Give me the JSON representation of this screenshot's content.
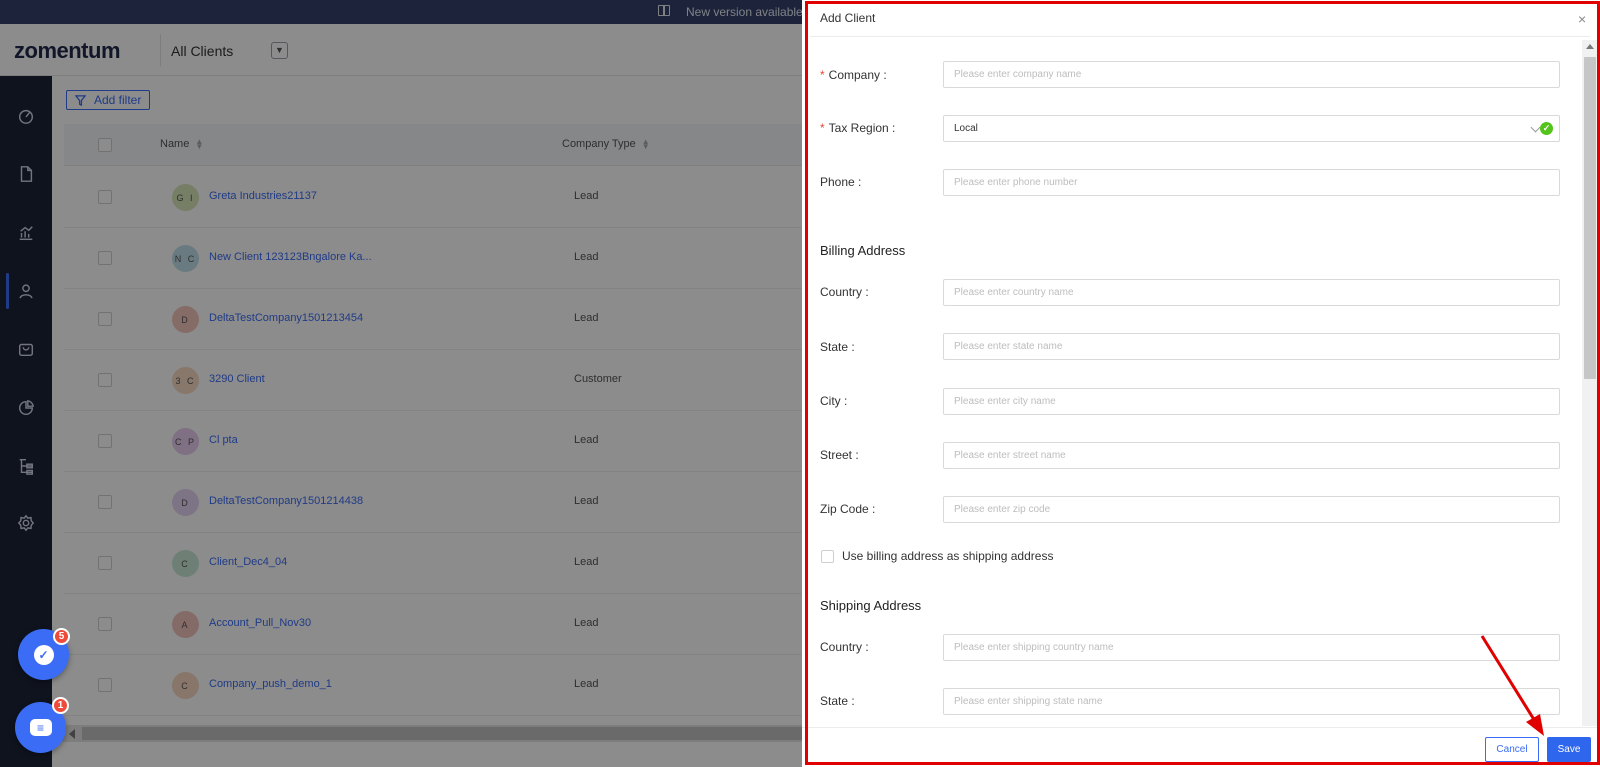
{
  "topbar": {
    "new_version": "New version available"
  },
  "header": {
    "logo": "zomentum",
    "view_name": "All Clients"
  },
  "sidebar": {
    "items": [
      {
        "icon": "dashboard-icon"
      },
      {
        "icon": "document-icon"
      },
      {
        "icon": "analytics-icon"
      },
      {
        "icon": "user-icon",
        "active": true
      },
      {
        "icon": "shopping-bag-icon"
      },
      {
        "icon": "pie-chart-icon"
      },
      {
        "icon": "workflow-icon"
      },
      {
        "icon": "settings-icon"
      }
    ]
  },
  "main": {
    "filter_label": "Add filter",
    "columns": {
      "name": "Name",
      "company_type": "Company Type"
    },
    "rows": [
      {
        "initials": "G I",
        "name": "Greta Industries21137",
        "type": "Lead",
        "color": "#d8e6b8"
      },
      {
        "initials": "N C",
        "name": "New Client 123123Bngalore     Ka...",
        "type": "Lead",
        "color": "#bfe0ea"
      },
      {
        "initials": "D",
        "name": "DeltaTestCompany1501213454",
        "type": "Lead",
        "color": "#f2c5bc"
      },
      {
        "initials": "3 C",
        "name": "3290 Client",
        "type": "Customer",
        "color": "#f7d9c4"
      },
      {
        "initials": "C P",
        "name": "Cl pta",
        "type": "Lead",
        "color": "#e7cdef"
      },
      {
        "initials": "D",
        "name": "DeltaTestCompany1501214438",
        "type": "Lead",
        "color": "#e3d3f2"
      },
      {
        "initials": "C",
        "name": "Client_Dec4_04",
        "type": "Lead",
        "color": "#c8e8d6"
      },
      {
        "initials": "A",
        "name": "Account_Pull_Nov30",
        "type": "Lead",
        "color": "#f3c3bd"
      },
      {
        "initials": "C",
        "name": "Company_push_demo_1",
        "type": "Lead",
        "color": "#f7d7c2"
      }
    ]
  },
  "fabs": {
    "tasks_badge": "5",
    "chat_badge": "1"
  },
  "drawer": {
    "title": "Add Client",
    "company": {
      "label": "Company",
      "placeholder": "Please enter company name"
    },
    "tax_region": {
      "label": "Tax Region",
      "value": "Local"
    },
    "phone": {
      "label": "Phone",
      "placeholder": "Please enter phone number"
    },
    "billing_title": "Billing Address",
    "billing": {
      "country": {
        "label": "Country",
        "placeholder": "Please enter country name"
      },
      "state": {
        "label": "State",
        "placeholder": "Please enter state name"
      },
      "city": {
        "label": "City",
        "placeholder": "Please enter city name"
      },
      "street": {
        "label": "Street",
        "placeholder": "Please enter street name"
      },
      "zip": {
        "label": "Zip Code",
        "placeholder": "Please enter zip code"
      }
    },
    "same_address_label": "Use billing address as shipping address",
    "shipping_title": "Shipping Address",
    "shipping": {
      "country": {
        "label": "Country",
        "placeholder": "Please enter shipping country name"
      },
      "state": {
        "label": "State",
        "placeholder": "Please enter shipping state name"
      }
    },
    "cancel_label": "Cancel",
    "save_label": "Save"
  },
  "colors": {
    "accent": "#3b6cf6",
    "sidebar": "#1c2438",
    "highlight": "#e00000"
  }
}
